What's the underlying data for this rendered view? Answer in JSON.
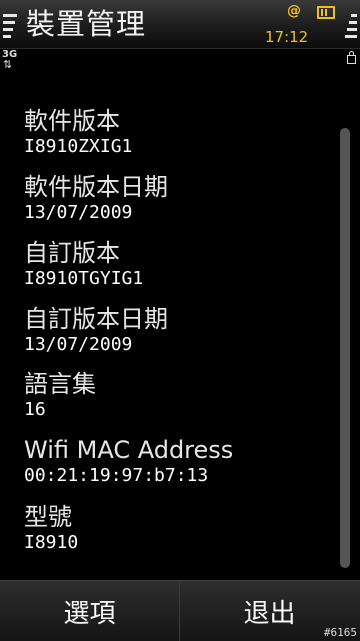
{
  "header": {
    "title": "裝置管理",
    "time": "17:12",
    "network": "3G"
  },
  "items": [
    {
      "label": "軟件版本",
      "value": "I8910ZXIG1"
    },
    {
      "label": "軟件版本日期",
      "value": "13/07/2009"
    },
    {
      "label": "自訂版本",
      "value": "I8910TGYIG1"
    },
    {
      "label": "自訂版本日期",
      "value": "13/07/2009"
    },
    {
      "label": "語言集",
      "value": "16"
    },
    {
      "label": "Wifi MAC Address",
      "value": "00:21:19:97:b7:13"
    },
    {
      "label": "型號",
      "value": "I8910"
    }
  ],
  "softkeys": {
    "left": "選項",
    "right": "退出"
  },
  "watermark": "#6165",
  "icons": [
    "signal-icon",
    "at-icon",
    "battery-icon",
    "lock-icon",
    "network-arrows-icon"
  ],
  "colors": {
    "accent": "#f0c020"
  }
}
